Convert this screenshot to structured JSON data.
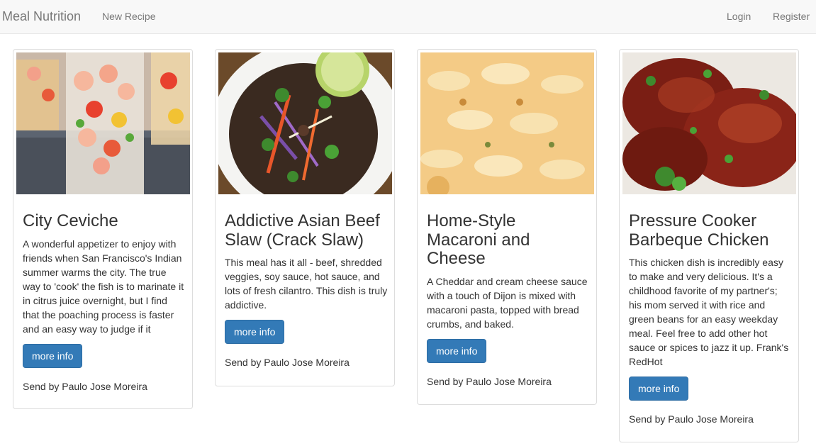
{
  "navbar": {
    "brand": "Meal Nutrition",
    "links": [
      "New Recipe"
    ],
    "right_links": [
      "Login",
      "Register"
    ]
  },
  "recipes": [
    {
      "title": "City Ceviche",
      "description": "A wonderful appetizer to enjoy with friends when San Francisco's Indian summer warms the city. The true way to 'cook' the fish is to marinate it in citrus juice overnight, but I find that the poaching process is faster and an easy way to judge if it",
      "button": "more info",
      "sender": "Send by Paulo Jose Moreira"
    },
    {
      "title": "Addictive Asian Beef Slaw (Crack Slaw)",
      "description": "This meal has it all - beef, shredded veggies, soy sauce, hot sauce, and lots of fresh cilantro. This dish is truly addictive.",
      "button": "more info",
      "sender": "Send by Paulo Jose Moreira"
    },
    {
      "title": "Home-Style Macaroni and Cheese",
      "description": "A Cheddar and cream cheese sauce with a touch of Dijon is mixed with macaroni pasta, topped with bread crumbs, and baked.",
      "button": "more info",
      "sender": "Send by Paulo Jose Moreira"
    },
    {
      "title": "Pressure Cooker Barbeque Chicken",
      "description": "This chicken dish is incredibly easy to make and very delicious. It's a childhood favorite of my partner's; his mom served it with rice and green beans for an easy weekday meal. Feel free to add other hot sauce or spices to jazz it up. Frank's RedHot",
      "button": "more info",
      "sender": "Send by Paulo Jose Moreira"
    }
  ],
  "colors": {
    "navbar_bg": "#f8f8f8",
    "button_bg": "#337ab7",
    "text": "#333333"
  }
}
